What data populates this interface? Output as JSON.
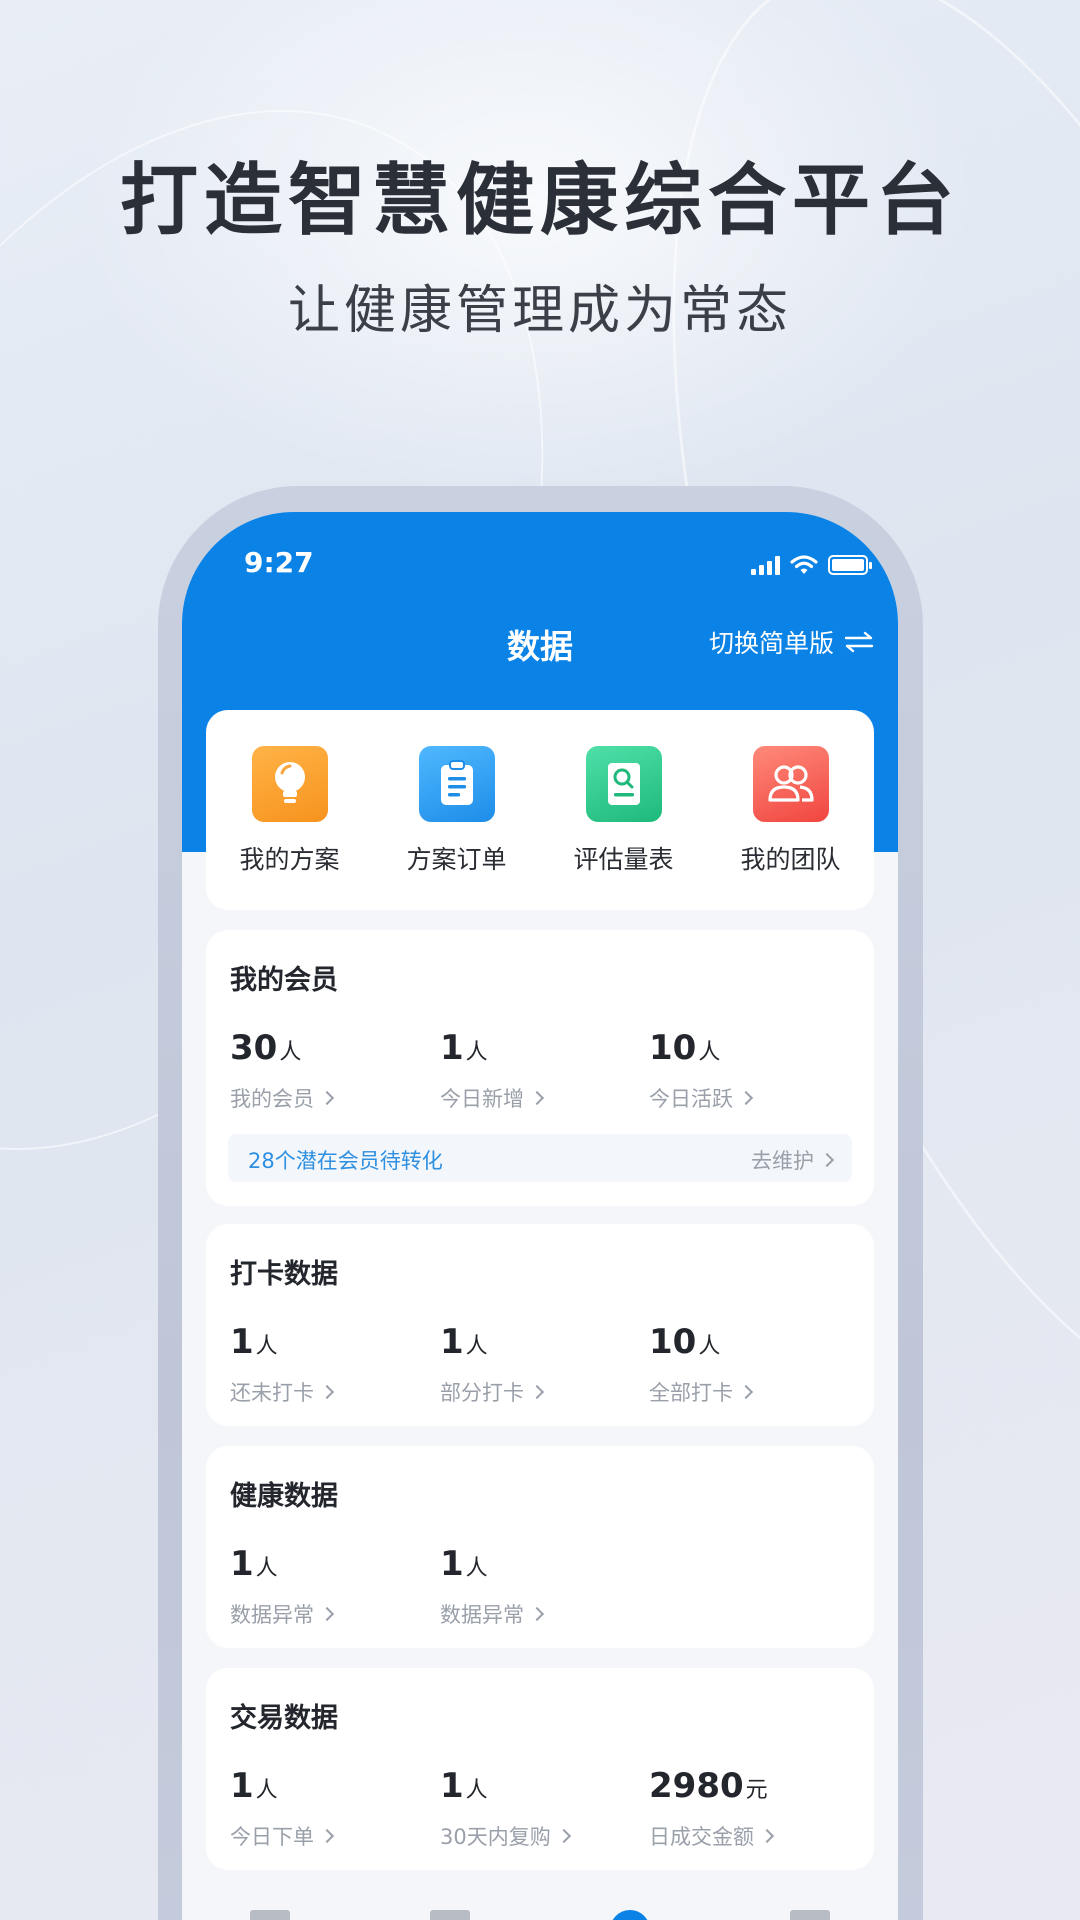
{
  "promo": {
    "headline": "打造智慧健康综合平台",
    "subline": "让健康管理成为常态"
  },
  "status_bar": {
    "time": "9:27"
  },
  "nav": {
    "title": "数据",
    "switch_label": "切换简单版"
  },
  "quick_actions": [
    {
      "label": "我的方案",
      "icon": "lightbulb-icon",
      "color": "#f7931e"
    },
    {
      "label": "方案订单",
      "icon": "clipboard-icon",
      "color": "#1e9bf0"
    },
    {
      "label": "评估量表",
      "icon": "assessment-doc-icon",
      "color": "#26c48a"
    },
    {
      "label": "我的团队",
      "icon": "team-icon",
      "color": "#f5534f"
    }
  ],
  "members": {
    "title": "我的会员",
    "stats": [
      {
        "value": "30",
        "unit": "人",
        "label": "我的会员"
      },
      {
        "value": "1",
        "unit": "人",
        "label": "今日新增"
      },
      {
        "value": "10",
        "unit": "人",
        "label": "今日活跃"
      }
    ],
    "hint": "28个潜在会员待转化",
    "hint_action": "去维护"
  },
  "checkin": {
    "title": "打卡数据",
    "stats": [
      {
        "value": "1",
        "unit": "人",
        "label": "还未打卡"
      },
      {
        "value": "1",
        "unit": "人",
        "label": "部分打卡"
      },
      {
        "value": "10",
        "unit": "人",
        "label": "全部打卡"
      }
    ]
  },
  "health": {
    "title": "健康数据",
    "stats": [
      {
        "value": "1",
        "unit": "人",
        "label": "数据异常"
      },
      {
        "value": "1",
        "unit": "人",
        "label": "数据异常"
      }
    ]
  },
  "trade": {
    "title": "交易数据",
    "stats": [
      {
        "value": "1",
        "unit": "人",
        "label": "今日下单"
      },
      {
        "value": "1",
        "unit": "人",
        "label": "30天内复购"
      },
      {
        "value": "2980",
        "unit": "元",
        "label": "日成交金额"
      }
    ]
  },
  "colors": {
    "primary": "#0a82e6",
    "link": "#2f8fe0"
  }
}
